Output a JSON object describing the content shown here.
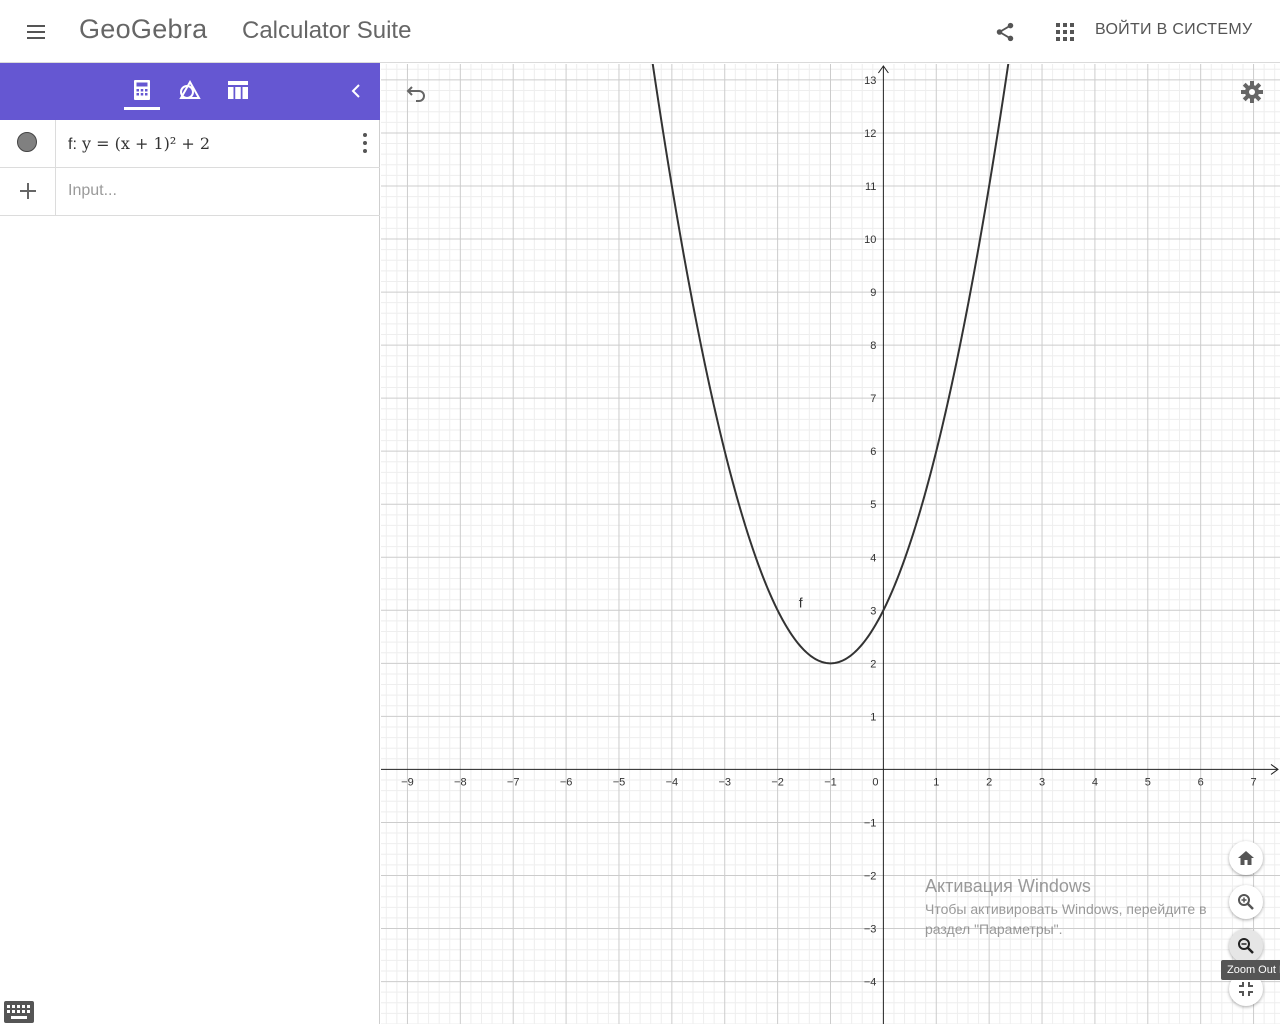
{
  "header": {
    "brand": "GeoGebra",
    "app_title": "Calculator Suite",
    "signin_label": "ВОЙТИ В СИСТЕМУ",
    "icons": [
      "menu-icon",
      "share-icon",
      "apps-grid-icon"
    ]
  },
  "toolbar": {
    "tabs": [
      {
        "icon": "calculator-icon",
        "active": true
      },
      {
        "icon": "geometry-icon",
        "active": false
      },
      {
        "icon": "table-icon",
        "active": false
      }
    ],
    "collapse_icon": "chevron-left-icon",
    "color": "#6557d2"
  },
  "algebra": {
    "items": [
      {
        "label": "f:",
        "expression_html": "y <span>=</span> (x + 1)² + 2"
      }
    ],
    "input_placeholder": "Input..."
  },
  "graphics": {
    "x_range": [
      -9.5,
      7.5
    ],
    "y_range": [
      -4.8,
      13.3
    ],
    "x_ticks": [
      -9,
      -8,
      -7,
      -6,
      -5,
      -4,
      -3,
      -2,
      -1,
      0,
      1,
      2,
      3,
      4,
      5,
      6,
      7
    ],
    "y_ticks": [
      -4,
      -3,
      -2,
      -1,
      1,
      2,
      3,
      4,
      5,
      6,
      7,
      8,
      9,
      10,
      11,
      12,
      13
    ],
    "function": {
      "label": "f",
      "a": 1,
      "h": -1,
      "k": 2,
      "color": "#333333"
    },
    "grid": true,
    "minor_grid": true
  },
  "controls": {
    "home_icon": "home-icon",
    "zoom_in_icon": "zoom-in-icon",
    "zoom_out_icon": "zoom-out-icon",
    "fullscreen_icon": "fullscreen-exit-icon",
    "tooltip": "Zoom Out R"
  },
  "watermark": {
    "title": "Активация Windows",
    "text": "Чтобы активировать Windows, перейдите в раздел \"Параметры\"."
  }
}
